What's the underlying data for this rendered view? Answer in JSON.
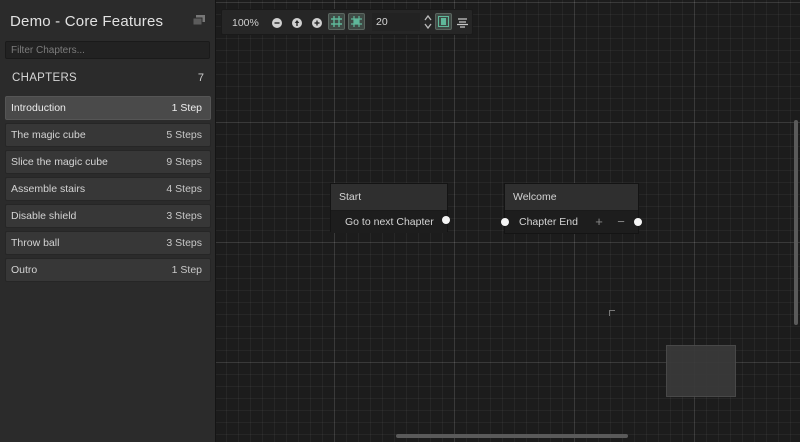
{
  "sidebar": {
    "title": "Demo - Core Features",
    "filter_placeholder": "Filter Chapters...",
    "section_title": "CHAPTERS",
    "chapter_count": "7",
    "chapters": [
      {
        "name": "Introduction",
        "steps": "1 Step",
        "selected": true
      },
      {
        "name": "The magic cube",
        "steps": "5 Steps"
      },
      {
        "name": "Slice the magic cube",
        "steps": "9 Steps"
      },
      {
        "name": "Assemble stairs",
        "steps": "4 Steps"
      },
      {
        "name": "Disable shield",
        "steps": "3 Steps"
      },
      {
        "name": "Throw ball",
        "steps": "3 Steps"
      },
      {
        "name": "Outro",
        "steps": "1 Step"
      }
    ]
  },
  "toolbar": {
    "zoom_level": "100%",
    "grid_snap_value": "20",
    "icons": [
      "zoom-out-icon",
      "reset-zoom-icon",
      "zoom-in-icon",
      "grid-toggle-icon",
      "snap-toggle-icon",
      "spinner-icon",
      "minimap-toggle-icon",
      "align-icon"
    ]
  },
  "graph": {
    "start_node": {
      "title": "Start",
      "output_label": "Go to next Chapter"
    },
    "step_node": {
      "title": "Welcome",
      "transition_label": "Chapter End",
      "add_symbol": "+",
      "remove_symbol": "−"
    }
  },
  "colors": {
    "accent": "#5fb89a",
    "canvas_bg": "#1c1c1c",
    "sidebar_bg": "#2b2b2b",
    "port": "#f4f4f4"
  }
}
